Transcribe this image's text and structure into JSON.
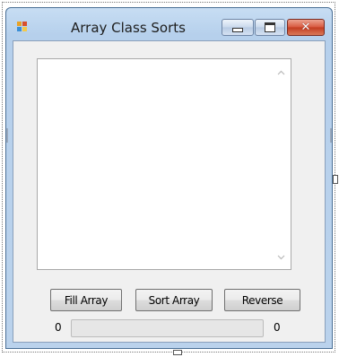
{
  "window": {
    "title": "Array Class Sorts",
    "icon": "app-icon",
    "controls": [
      "minimize-icon",
      "maximize-icon",
      "close-icon"
    ],
    "close_glyph": "✕"
  },
  "listbox": {
    "items": [],
    "scroll_up_icon": "chevron-up-icon",
    "scroll_down_icon": "chevron-down-icon"
  },
  "buttons": {
    "fill": "Fill Array",
    "sort": "Sort Array",
    "reverse": "Reverse"
  },
  "progress": {
    "min_label": "0",
    "max_label": "0",
    "value_fraction": 0
  },
  "colors": {
    "title_bar": "#bad2ec",
    "client_bg": "#f0f0f0",
    "close_button": "#c23b1f",
    "progress_fill": "#06b025"
  }
}
